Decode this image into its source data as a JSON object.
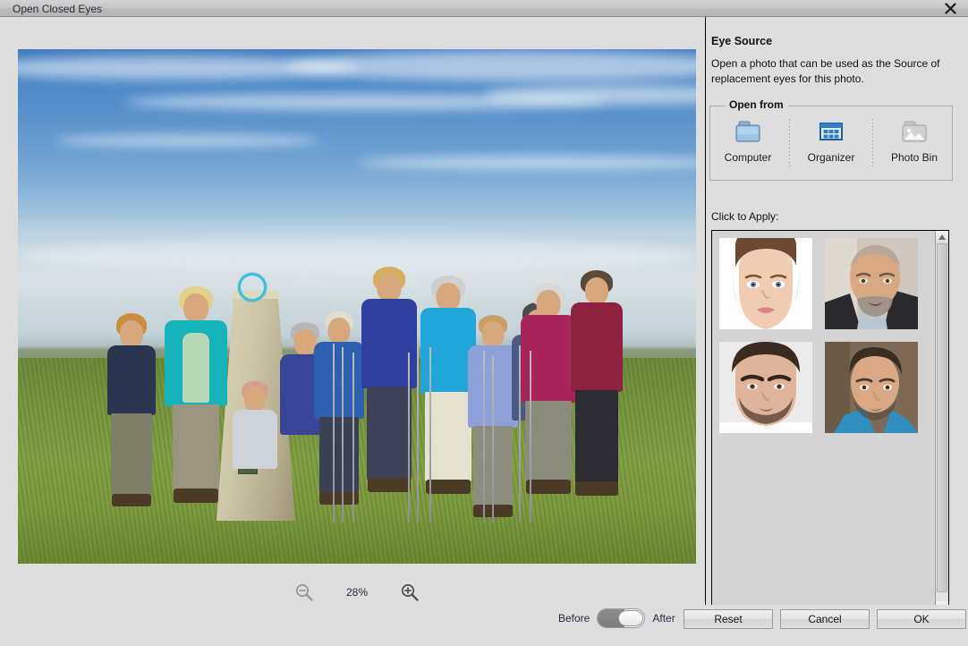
{
  "window": {
    "title": "Open Closed Eyes",
    "close_icon": "close-icon"
  },
  "canvas": {
    "zoom_out_icon": "zoom-out-icon",
    "zoom_in_icon": "zoom-in-icon",
    "zoom_level": "28%",
    "photo_alt": "Group of hikers standing around a stone trig pillar on a grassy hilltop under a blue sky",
    "selection_color": "#2ec4e6"
  },
  "sidebar": {
    "heading": "Eye Source",
    "description": "Open a photo that can be used as the Source of replacement eyes for this photo.",
    "open_from": {
      "legend": "Open from",
      "items": [
        {
          "label": "Computer",
          "icon": "folder-icon"
        },
        {
          "label": "Organizer",
          "icon": "grid-icon"
        },
        {
          "label": "Photo Bin",
          "icon": "photo-icon"
        }
      ]
    },
    "apply_label": "Click to Apply:",
    "thumbnails": [
      {
        "name": "thumbnail-female-studio-portrait"
      },
      {
        "name": "thumbnail-older-man-portrait"
      },
      {
        "name": "thumbnail-young-man-portrait"
      },
      {
        "name": "thumbnail-man-blue-shirt-portrait"
      }
    ],
    "scrollbar": {
      "up_icon": "scroll-up-icon",
      "down_icon": "scroll-down-icon"
    }
  },
  "footer": {
    "before_label": "Before",
    "after_label": "After",
    "toggle_state": "after",
    "buttons": [
      {
        "label": "Reset",
        "name": "reset-button"
      },
      {
        "label": "Cancel",
        "name": "cancel-button"
      },
      {
        "label": "OK",
        "name": "ok-button"
      }
    ]
  }
}
